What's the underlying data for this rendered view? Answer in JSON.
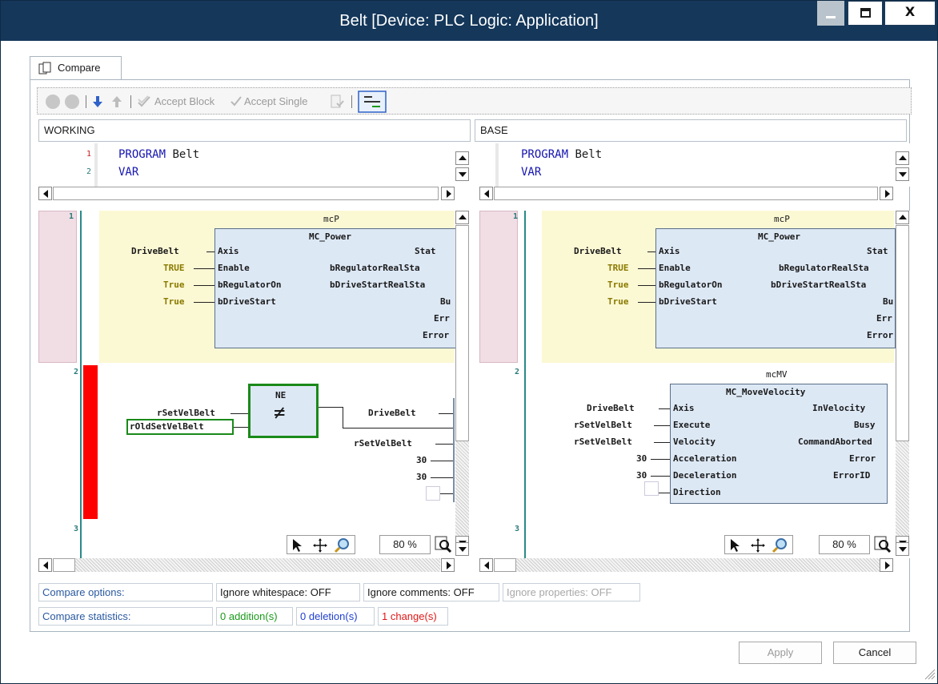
{
  "window": {
    "title": "Belt [Device: PLC Logic: Application]"
  },
  "tab": {
    "label": "Compare"
  },
  "toolbar": {
    "accept_block": "Accept Block",
    "accept_single": "Accept Single"
  },
  "panes": {
    "working_label": "WORKING",
    "base_label": "BASE"
  },
  "code": {
    "lines": [
      {
        "num": "1",
        "keyword": "PROGRAM",
        "rest": " Belt"
      },
      {
        "num": "2",
        "keyword": "VAR",
        "rest": ""
      }
    ]
  },
  "network": {
    "n1": "1",
    "n2": "2",
    "n3": "3"
  },
  "fbd_working": {
    "instance": "mcP",
    "block": "MC_Power",
    "inputs": [
      {
        "value": "DriveBelt",
        "pin": "Axis"
      },
      {
        "value": "TRUE",
        "pin": "Enable"
      },
      {
        "value": "True",
        "pin": "bRegulatorOn"
      },
      {
        "value": "True",
        "pin": "bDriveStart"
      }
    ],
    "outputs": [
      "Stat",
      "bRegulatorRealSta",
      "bDriveStartRealSta",
      "Bu",
      "Err",
      "Error"
    ],
    "ne_block": "NE",
    "ne_symbol": "≠",
    "ne_in1": "rSetVelBelt",
    "ne_in2": "rOldSetVelBelt",
    "right_inputs": [
      "DriveBelt",
      "rSetVelBelt",
      "30",
      "30"
    ]
  },
  "fbd_base": {
    "instance": "mcP",
    "block": "MC_Power",
    "inputs": [
      {
        "value": "DriveBelt",
        "pin": "Axis"
      },
      {
        "value": "TRUE",
        "pin": "Enable"
      },
      {
        "value": "True",
        "pin": "bRegulatorOn"
      },
      {
        "value": "True",
        "pin": "bDriveStart"
      }
    ],
    "outputs": [
      "Stat",
      "bRegulatorRealSta",
      "bDriveStartRealSta",
      "Bu",
      "Err",
      "Error"
    ],
    "mv_instance": "mcMV",
    "mv_block": "MC_MoveVelocity",
    "mv_inputs": [
      {
        "value": "DriveBelt",
        "pin": "Axis"
      },
      {
        "value": "rSetVelBelt",
        "pin": "Execute"
      },
      {
        "value": "rSetVelBelt",
        "pin": "Velocity"
      },
      {
        "value": "30",
        "pin": "Acceleration"
      },
      {
        "value": "30",
        "pin": "Deceleration"
      },
      {
        "value": "",
        "pin": "Direction"
      }
    ],
    "mv_outputs": [
      "InVelocity",
      "Busy",
      "CommandAborted",
      "Error",
      "ErrorID"
    ]
  },
  "zoom": {
    "working": "80 %",
    "base": "80 %"
  },
  "compare_options": {
    "label": "Compare options:",
    "whitespace": "Ignore whitespace: OFF",
    "comments": "Ignore comments: OFF",
    "properties": "Ignore properties: OFF"
  },
  "compare_statistics": {
    "label": "Compare statistics:",
    "additions": "0 addition(s)",
    "deletions": "0 deletion(s)",
    "changes": "1 change(s)"
  },
  "buttons": {
    "apply": "Apply",
    "cancel": "Cancel"
  },
  "colors": {
    "titlebar": "#14375a",
    "added": "#1a9a1a",
    "deleted": "#1f3fd0",
    "changed": "#e01818",
    "keyword": "#1515b0",
    "diff_marker": "#ff0000",
    "diff_removed_bg": "#f1dde4",
    "highlight_bg": "#fbf8d4"
  }
}
